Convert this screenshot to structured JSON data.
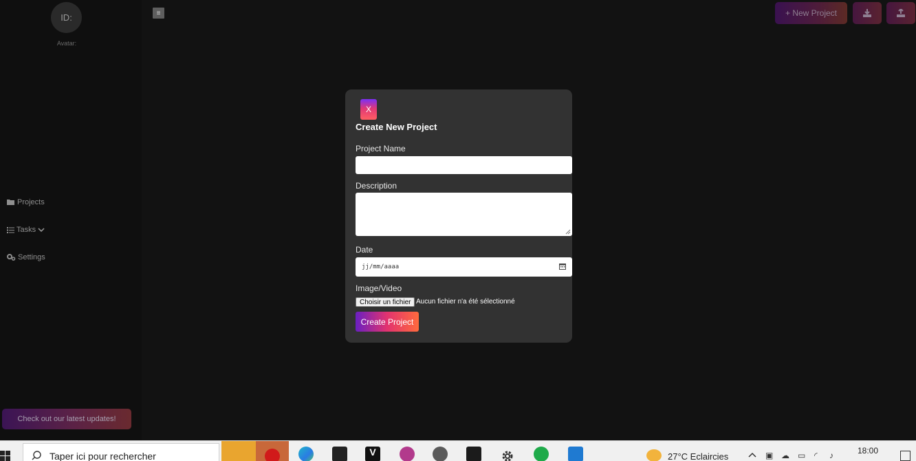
{
  "sidebar": {
    "avatar_text": "ID:",
    "avatar_label": "Avatar:",
    "items": [
      {
        "label": "Projects",
        "icon": "folder-icon"
      },
      {
        "label": "Tasks",
        "icon": "list-icon"
      },
      {
        "label": "Settings",
        "icon": "gears-icon"
      }
    ],
    "updates_label": "Check out our latest updates!"
  },
  "header": {
    "menu_icon": "≡",
    "new_project_label": "+ New Project",
    "download_icon": "download-icon",
    "upload_icon": "upload-icon"
  },
  "modal": {
    "close_label": "X",
    "title": "Create New Project",
    "project_name_label": "Project Name",
    "project_name_value": "",
    "description_label": "Description",
    "description_value": "",
    "date_label": "Date",
    "date_placeholder": "jj/mm/aaaa",
    "media_label": "Image/Video",
    "file_button_label": "Choisir un fichier",
    "file_status": "Aucun fichier n'a été sélectionné",
    "submit_label": "Create Project"
  },
  "taskbar": {
    "search_placeholder": "Taper ici pour rechercher",
    "weather": "27°C  Eclaircies",
    "time": "18:00"
  },
  "colors": {
    "background": "#121212",
    "sidebar": "#0f0f0f",
    "modal": "#323232",
    "accent_start": "#6a1fc1",
    "accent_mid": "#e2336f",
    "accent_end": "#ff6a3d"
  }
}
